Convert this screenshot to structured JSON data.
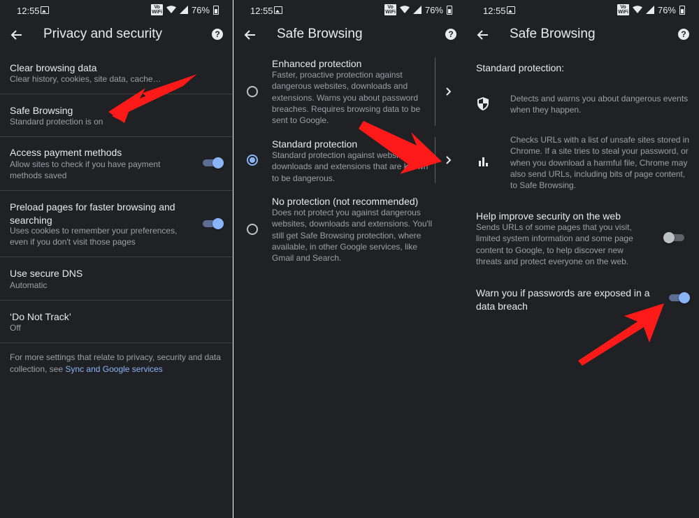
{
  "status_bar": {
    "time": "12:55",
    "volte": "Vo\nWiFi",
    "battery": "76%"
  },
  "panel1": {
    "title": "Privacy and security",
    "help": "?",
    "items": [
      {
        "title": "Clear browsing data",
        "subtitle": "Clear history, cookies, site data, cache…"
      },
      {
        "title": "Safe Browsing",
        "subtitle": "Standard protection is on"
      },
      {
        "title": "Access payment methods",
        "subtitle": "Allow sites to check if you have payment methods saved",
        "toggle": "on"
      },
      {
        "title": "Preload pages for faster browsing and searching",
        "subtitle": "Uses cookies to remember your preferences, even if you don't visit those pages",
        "toggle": "on"
      },
      {
        "title": "Use secure DNS",
        "subtitle": "Automatic"
      },
      {
        "title": "‘Do Not Track’",
        "subtitle": "Off"
      }
    ],
    "footer_text": "For more settings that relate to privacy, security and data collection, see ",
    "footer_link": "Sync and Google services"
  },
  "panel2": {
    "title": "Safe Browsing",
    "help": "?",
    "options": [
      {
        "title": "Enhanced protection",
        "description": "Faster, proactive protection against dangerous websites, downloads and extensions. Warns you about password breaches. Requires browsing data to be sent to Google.",
        "selected": false
      },
      {
        "title": "Standard protection",
        "description": "Standard protection against websites, downloads and extensions that are known to be dangerous.",
        "selected": true
      },
      {
        "title": "No protection (not recommended)",
        "description": "Does not protect you against dangerous websites, downloads and extensions. You'll still get Safe Browsing protection, where available, in other Google services, like Gmail and Search.",
        "selected": false
      }
    ]
  },
  "panel3": {
    "title": "Safe Browsing",
    "help": "?",
    "section_heading": "Standard protection:",
    "features": [
      {
        "icon": "shield-icon",
        "text": "Detects and warns you about dangerous events when they happen."
      },
      {
        "icon": "bar-chart-icon",
        "text": "Checks URLs with a list of unsafe sites stored in Chrome. If a site tries to steal your password, or when you download a harmful file, Chrome may also send URLs, including bits of page content, to Safe Browsing."
      }
    ],
    "help_improve": {
      "title": "Help improve security on the web",
      "description": "Sends URLs of some pages that you visit, limited system information and some page content to Google, to help discover new threats and protect everyone on the web.",
      "toggle": "off"
    },
    "warn_passwords": {
      "title": "Warn you if passwords are exposed in a data breach",
      "toggle": "on"
    }
  },
  "colors": {
    "background": "#202124",
    "text_primary": "#e8eaed",
    "text_secondary": "#9aa0a6",
    "accent": "#8ab4f8",
    "annotation_arrow": "#ff1a1a"
  }
}
